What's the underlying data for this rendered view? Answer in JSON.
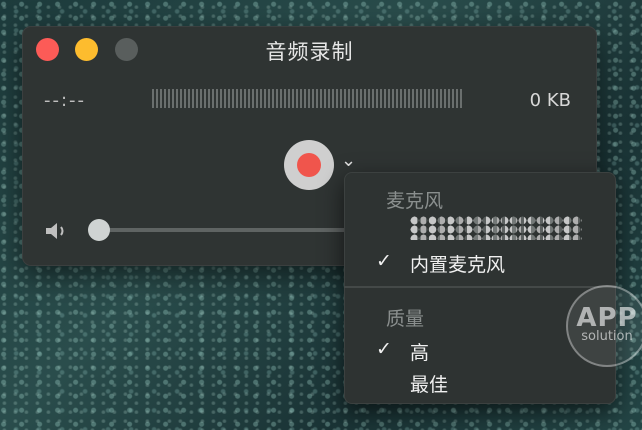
{
  "window": {
    "title": "音频录制",
    "elapsed_time": "--:--",
    "file_size": "0 KB"
  },
  "controls": {
    "record_icon": "record-icon",
    "options_chevron": "chevron-down-icon",
    "volume_icon": "speaker-icon"
  },
  "menu": {
    "microphone_header": "麦克风",
    "microphone_items": [
      {
        "label": "",
        "checked": false,
        "note": "pixelated"
      },
      {
        "label": "内置麦克风",
        "checked": true
      }
    ],
    "quality_header": "质量",
    "quality_items": [
      {
        "label": "高",
        "checked": true
      },
      {
        "label": "最佳",
        "checked": false
      }
    ],
    "check_glyph": "✓"
  },
  "watermark": {
    "line1": "APP",
    "line2": "solution"
  }
}
